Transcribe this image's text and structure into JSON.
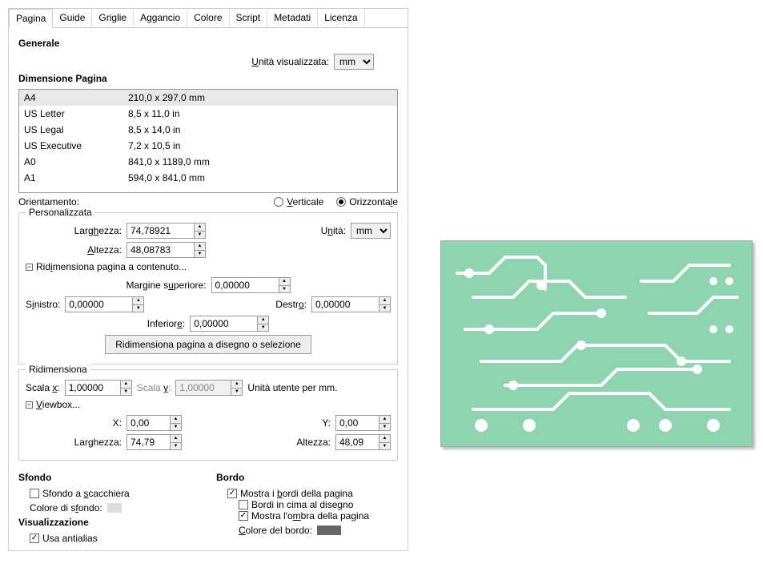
{
  "tabs": [
    "Pagina",
    "Guide",
    "Griglie",
    "Aggancio",
    "Colore",
    "Script",
    "Metadati",
    "Licenza"
  ],
  "general": {
    "title": "Generale",
    "unit_label": "Unità visualizzata:",
    "unit_value": "mm"
  },
  "page_size": {
    "title": "Dimensione Pagina",
    "rows": [
      {
        "name": "A4",
        "dim": "210,0 x 297,0 mm"
      },
      {
        "name": "US Letter",
        "dim": "8,5 x 11,0 in"
      },
      {
        "name": "US Legal",
        "dim": "8,5 x 14,0 in"
      },
      {
        "name": "US Executive",
        "dim": "7,2 x 10,5 in"
      },
      {
        "name": "A0",
        "dim": "841,0 x 1189,0 mm"
      },
      {
        "name": "A1",
        "dim": "594,0 x 841,0 mm"
      }
    ]
  },
  "orient": {
    "label": "Orientamento:",
    "v": "Verticale",
    "h": "Orizzontale"
  },
  "custom": {
    "legend": "Personalizzata",
    "width_l": "Larghezza:",
    "width_v": "74,78921",
    "height_l": "Altezza:",
    "height_v": "48,08783",
    "unit_l": "Unità:",
    "unit_v": "mm",
    "resize_expand": "Ridimensiona pagina a contenuto...",
    "m_top_l": "Margine superiore:",
    "m_top_v": "0,00000",
    "m_left_l": "Sinistro:",
    "m_left_v": "0,00000",
    "m_right_l": "Destro:",
    "m_right_v": "0,00000",
    "m_bot_l": "Inferiore:",
    "m_bot_v": "0,00000",
    "btn": "Ridimensiona pagina a disegno o selezione"
  },
  "scale": {
    "legend": "Ridimensiona",
    "sx_l": "Scala x:",
    "sx_v": "1,00000",
    "sy_l": "Scala y:",
    "sy_v": "1,00000",
    "unit": "Unità utente per mm.",
    "vb": "Viewbox...",
    "x_l": "X:",
    "x_v": "0,00",
    "y_l": "Y:",
    "y_v": "0,00",
    "w_l": "Larghezza:",
    "w_v": "74,79",
    "h_l": "Altezza:",
    "h_v": "48,09"
  },
  "bg": {
    "title": "Sfondo",
    "chk": "Sfondo a scacchiera",
    "color_l": "Colore di sfondo:"
  },
  "display": {
    "title": "Visualizzazione",
    "aa": "Usa antialias"
  },
  "border": {
    "title": "Bordo",
    "show": "Mostra i bordi della pagina",
    "top": "Bordi in cima al disegno",
    "shadow": "Mostra l'ombra della pagina",
    "color_l": "Colore del bordo:"
  }
}
